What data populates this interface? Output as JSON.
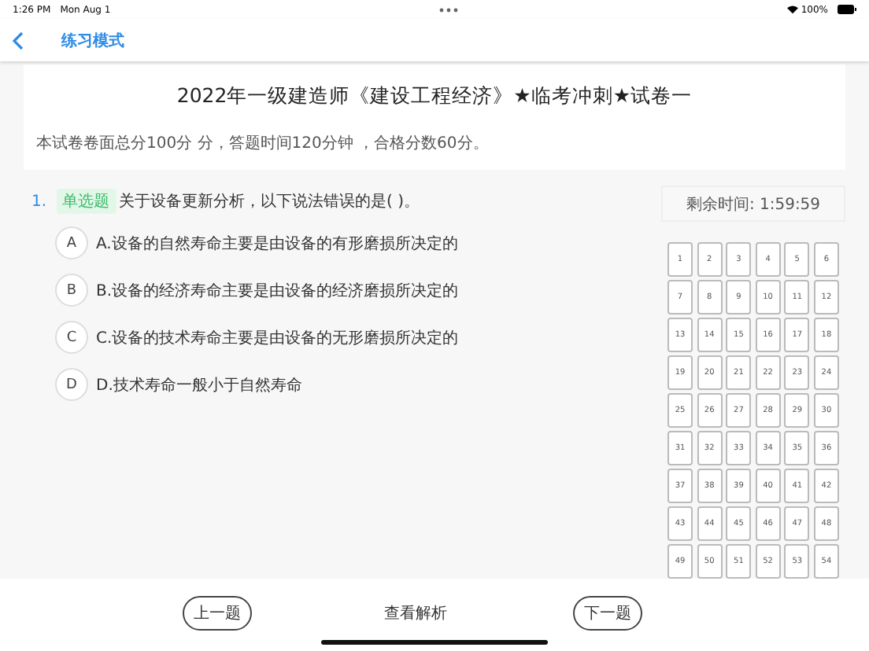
{
  "status_bar": {
    "time": "1:26 PM",
    "date": "Mon Aug 1",
    "battery": "100%"
  },
  "nav": {
    "title": "练习模式"
  },
  "paper": {
    "title": "2022年一级建造师《建设工程经济》★临考冲刺★试卷一",
    "intro": "本试卷卷面总分100分 分，答题时间120分钟 ，合格分数60分。"
  },
  "question": {
    "number": "1.",
    "tag": "单选题",
    "text": "关于设备更新分析，以下说法错误的是(   )。",
    "options": [
      {
        "letter": "A",
        "text": "A.设备的自然寿命主要是由设备的有形磨损所决定的",
        "selected": false
      },
      {
        "letter": "B",
        "text": "B.设备的经济寿命主要是由设备的经济磨损所决定的",
        "selected": false
      },
      {
        "letter": "C",
        "text": "C.设备的技术寿命主要是由设备的无形磨损所决定的",
        "selected": false
      },
      {
        "letter": "D",
        "text": "D.技术寿命一般小于自然寿命",
        "selected": false
      }
    ]
  },
  "timer": "剩余时间: 1:59:59",
  "answer_card": [
    "1",
    "2",
    "3",
    "4",
    "5",
    "6",
    "7",
    "8",
    "9",
    "10",
    "11",
    "12",
    "13",
    "14",
    "15",
    "16",
    "17",
    "18",
    "19",
    "20",
    "21",
    "22",
    "23",
    "24",
    "25",
    "26",
    "27",
    "28",
    "29",
    "30",
    "31",
    "32",
    "33",
    "34",
    "35",
    "36",
    "37",
    "38",
    "39",
    "40",
    "41",
    "42",
    "43",
    "44",
    "45",
    "46",
    "47",
    "48",
    "49",
    "50",
    "51",
    "52",
    "53",
    "54"
  ],
  "buttons": {
    "prev": "上一题",
    "analysis": "查看解析",
    "next": "下一题"
  }
}
